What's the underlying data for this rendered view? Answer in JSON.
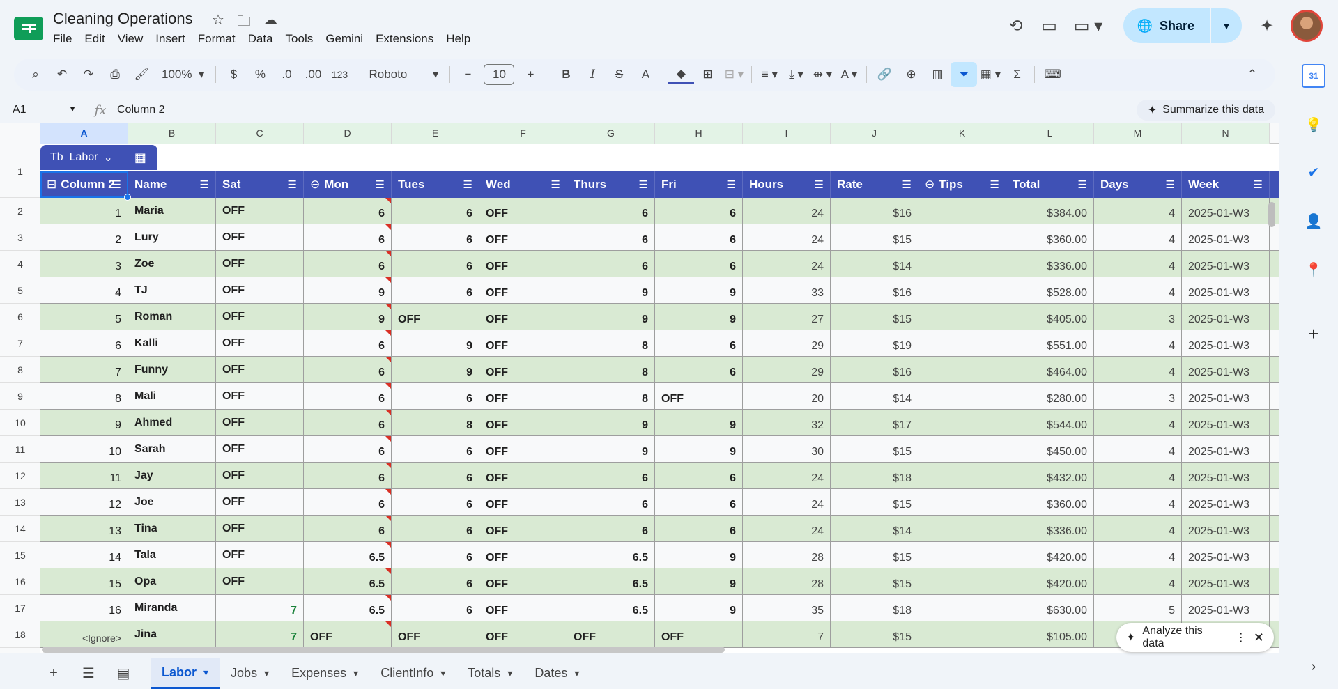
{
  "app": {
    "title": "Cleaning Operations",
    "menus": [
      "File",
      "Edit",
      "View",
      "Insert",
      "Format",
      "Data",
      "Tools",
      "Gemini",
      "Extensions",
      "Help"
    ],
    "share_label": "Share",
    "accent": "#c2e7ff"
  },
  "toolbar": {
    "zoom": "100%",
    "currency": "$",
    "percent": "%",
    "dec_less": ".0",
    "dec_more": ".00",
    "num_format": "123",
    "font": "Roboto",
    "font_size": "10",
    "minus": "−",
    "plus": "+"
  },
  "formula": {
    "cell": "A1",
    "fx": "fx",
    "content": "Column 2",
    "summarize": "Summarize this data"
  },
  "columns": [
    "A",
    "B",
    "C",
    "D",
    "E",
    "F",
    "G",
    "H",
    "I",
    "J",
    "K",
    "L",
    "M",
    "N"
  ],
  "row_numbers": [
    "1",
    "2",
    "3",
    "4",
    "5",
    "6",
    "7",
    "8",
    "9",
    "10",
    "11",
    "12",
    "13",
    "14",
    "15",
    "16",
    "17",
    "18"
  ],
  "table": {
    "name": "Tb_Labor",
    "headers": [
      "Column 2",
      "Name",
      "Sat",
      "Mon",
      "Tues",
      "Wed",
      "Thurs",
      "Fri",
      "Hours",
      "Rate",
      "Tips",
      "Total",
      "Days",
      "Week"
    ],
    "header_color": "#3f51b5",
    "band_color": "#d9ead3",
    "rows": [
      [
        "1",
        "Maria",
        "OFF",
        "6",
        "6",
        "OFF",
        "6",
        "6",
        "24",
        "$16",
        "",
        "$384.00",
        "4",
        "2025-01-W3"
      ],
      [
        "2",
        "Lury",
        "OFF",
        "6",
        "6",
        "OFF",
        "6",
        "6",
        "24",
        "$15",
        "",
        "$360.00",
        "4",
        "2025-01-W3"
      ],
      [
        "3",
        "Zoe",
        "OFF",
        "6",
        "6",
        "OFF",
        "6",
        "6",
        "24",
        "$14",
        "",
        "$336.00",
        "4",
        "2025-01-W3"
      ],
      [
        "4",
        "TJ",
        "OFF",
        "9",
        "6",
        "OFF",
        "9",
        "9",
        "33",
        "$16",
        "",
        "$528.00",
        "4",
        "2025-01-W3"
      ],
      [
        "5",
        "Roman",
        "OFF",
        "9",
        "OFF",
        "OFF",
        "9",
        "9",
        "27",
        "$15",
        "",
        "$405.00",
        "3",
        "2025-01-W3"
      ],
      [
        "6",
        "Kalli",
        "OFF",
        "6",
        "9",
        "OFF",
        "8",
        "6",
        "29",
        "$19",
        "",
        "$551.00",
        "4",
        "2025-01-W3"
      ],
      [
        "7",
        "Funny",
        "OFF",
        "6",
        "9",
        "OFF",
        "8",
        "6",
        "29",
        "$16",
        "",
        "$464.00",
        "4",
        "2025-01-W3"
      ],
      [
        "8",
        "Mali",
        "OFF",
        "6",
        "6",
        "OFF",
        "8",
        "OFF",
        "20",
        "$14",
        "",
        "$280.00",
        "3",
        "2025-01-W3"
      ],
      [
        "9",
        "Ahmed",
        "OFF",
        "6",
        "8",
        "OFF",
        "9",
        "9",
        "32",
        "$17",
        "",
        "$544.00",
        "4",
        "2025-01-W3"
      ],
      [
        "10",
        "Sarah",
        "OFF",
        "6",
        "6",
        "OFF",
        "9",
        "9",
        "30",
        "$15",
        "",
        "$450.00",
        "4",
        "2025-01-W3"
      ],
      [
        "11",
        "Jay",
        "OFF",
        "6",
        "6",
        "OFF",
        "6",
        "6",
        "24",
        "$18",
        "",
        "$432.00",
        "4",
        "2025-01-W3"
      ],
      [
        "12",
        "Joe",
        "OFF",
        "6",
        "6",
        "OFF",
        "6",
        "6",
        "24",
        "$15",
        "",
        "$360.00",
        "4",
        "2025-01-W3"
      ],
      [
        "13",
        "Tina",
        "OFF",
        "6",
        "6",
        "OFF",
        "6",
        "6",
        "24",
        "$14",
        "",
        "$336.00",
        "4",
        "2025-01-W3"
      ],
      [
        "14",
        "Tala",
        "OFF",
        "6.5",
        "6",
        "OFF",
        "6.5",
        "9",
        "28",
        "$15",
        "",
        "$420.00",
        "4",
        "2025-01-W3"
      ],
      [
        "15",
        "Opa",
        "OFF",
        "6.5",
        "6",
        "OFF",
        "6.5",
        "9",
        "28",
        "$15",
        "",
        "$420.00",
        "4",
        "2025-01-W3"
      ],
      [
        "16",
        "Miranda",
        "7",
        "6.5",
        "6",
        "OFF",
        "6.5",
        "9",
        "35",
        "$18",
        "",
        "$630.00",
        "5",
        "2025-01-W3"
      ],
      [
        "<Ignore>",
        "Jina",
        "7",
        "OFF",
        "OFF",
        "OFF",
        "OFF",
        "OFF",
        "7",
        "$15",
        "",
        "$105.00",
        "",
        ""
      ]
    ]
  },
  "analyze_label": "Analyze this data",
  "sheets": [
    {
      "label": "Labor",
      "active": true
    },
    {
      "label": "Jobs"
    },
    {
      "label": "Expenses"
    },
    {
      "label": "ClientInfo"
    },
    {
      "label": "Totals"
    },
    {
      "label": "Dates"
    }
  ]
}
